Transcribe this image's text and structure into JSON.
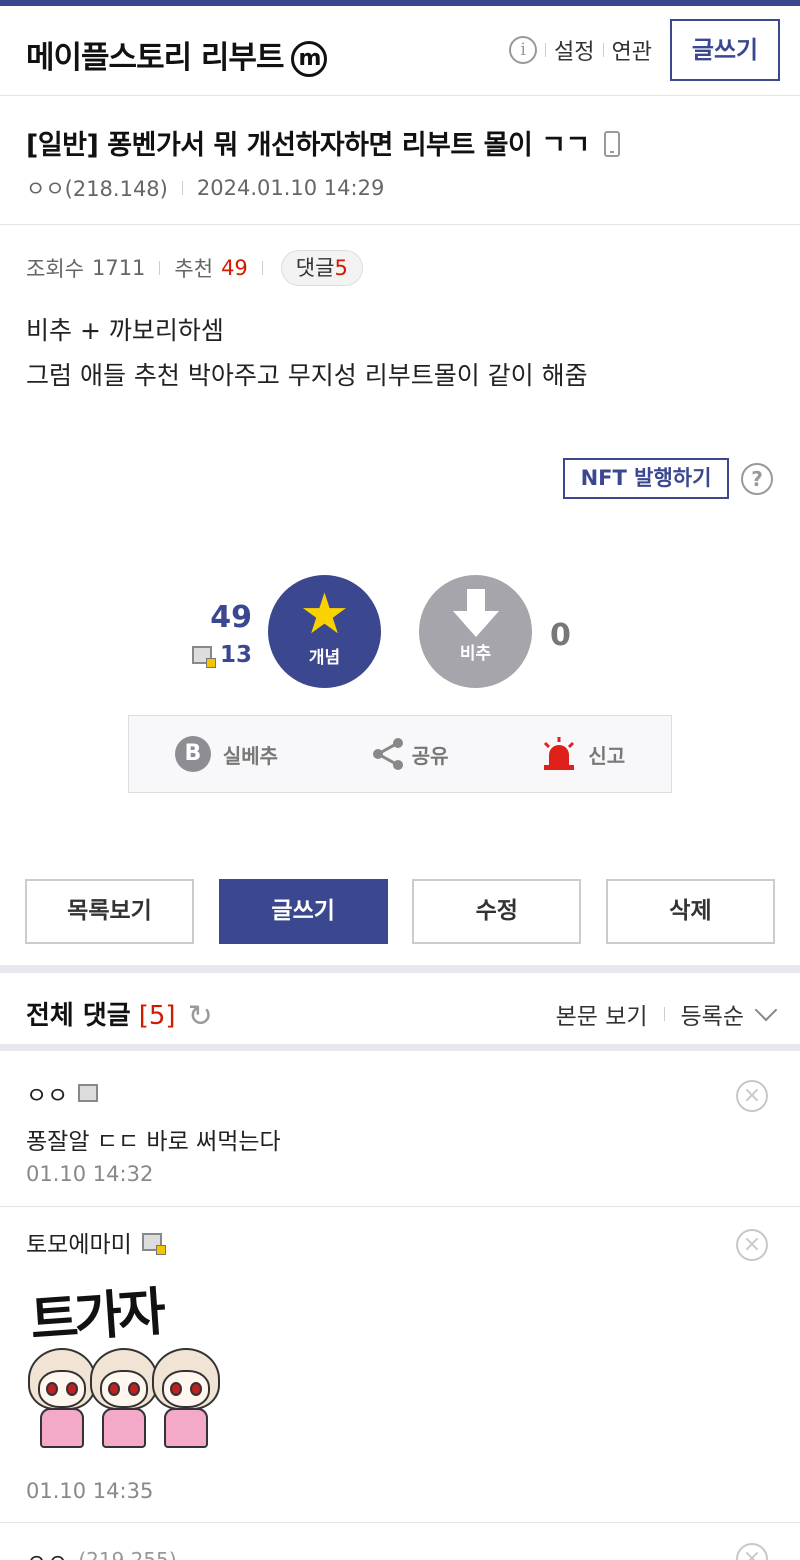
{
  "header": {
    "gallery_name": "메이플스토리 리부트",
    "minor_badge": "m",
    "info_icon": "i",
    "links": [
      "설정",
      "연관"
    ],
    "write_label": "글쓰기"
  },
  "post": {
    "title": "[일반] 퐁벤가서 뭐 개선하자하면 리부트 몰이 ㄱㄱ",
    "author": "ㅇㅇ(218.148)",
    "date": "2024.01.10 14:29",
    "views_label": "조회수",
    "views": "1711",
    "recommend_label": "추천",
    "recommend": "49",
    "comment_label": "댓글",
    "comment_count": "5",
    "body_lines": [
      "비추 + 까보리하셈",
      "그럼 애들 추천 박아주고 무지성 리부트몰이 같이 해줌"
    ]
  },
  "nft": {
    "label": "NFT 발행하기",
    "help": "?"
  },
  "vote": {
    "up_count": "49",
    "fix_count": "13",
    "up_label": "개념",
    "down_label": "비추",
    "down_count": "0"
  },
  "actions": {
    "best_icon": "B",
    "best_label": "실베추",
    "share_label": "공유",
    "report_label": "신고"
  },
  "buttons": {
    "list": "목록보기",
    "write": "글쓰기",
    "edit": "수정",
    "delete": "삭제"
  },
  "comments_header": {
    "title": "전체 댓글",
    "count": "[5]",
    "refresh_icon": "↻",
    "view_body": "본문 보기",
    "sort": "등록순"
  },
  "comments": [
    {
      "author": "ㅇㅇ",
      "text": "퐁잘알 ㄷㄷ 바로 써먹는다",
      "time": "01.10 14:32",
      "delete": "×"
    },
    {
      "author": "토모에마미",
      "dccon_text": "트가자",
      "time": "01.10 14:35",
      "delete": "×"
    },
    {
      "author": "ㅇㅇ",
      "ip": "(219.255)",
      "delete": "×"
    }
  ],
  "colors": {
    "accent": "#3b4890",
    "red": "#d31900",
    "star": "#f9d200"
  }
}
